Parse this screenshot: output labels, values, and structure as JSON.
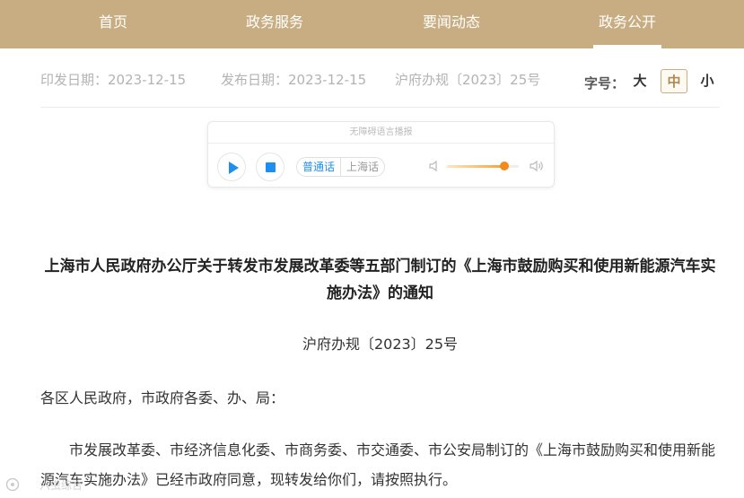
{
  "nav": {
    "items": [
      {
        "label": "首页"
      },
      {
        "label": "政务服务"
      },
      {
        "label": "要闻动态"
      },
      {
        "label": "政务公开"
      }
    ]
  },
  "meta": {
    "issue_date": "印发日期：2023-12-15",
    "publish_date": "发布日期：2023-12-15",
    "doc_number": "沪府办规〔2023〕25号"
  },
  "font_size": {
    "label": "字号：",
    "large": "大",
    "medium": "中",
    "small": "小",
    "selected": "中"
  },
  "player": {
    "header": "无障碍语言播报",
    "lang_mandarin": "普通话",
    "lang_shanghai": "上海话",
    "selected_lang": "普通话",
    "volume": 0.8
  },
  "article": {
    "title": "上海市人民政府办公厅关于转发市发展改革委等五部门制订的《上海市鼓励购买和使用新能源汽车实施办法》的通知",
    "doc_number": "沪府办规〔2023〕25号",
    "salutation": "各区人民政府，市政府各委、办、局：",
    "body": "市发展改革委、市经济信息化委、市商务委、市交通委、市公安局制订的《上海市鼓励购买和使用新能源汽车实施办法》已经市政府同意，现转发给你们，请按照执行。"
  },
  "watermark": {
    "text": "六虫综合"
  },
  "colors": {
    "nav_bg": "#c9ad82",
    "accent_blue": "#1d8ff0",
    "volume_orange": "#f28b1e"
  }
}
